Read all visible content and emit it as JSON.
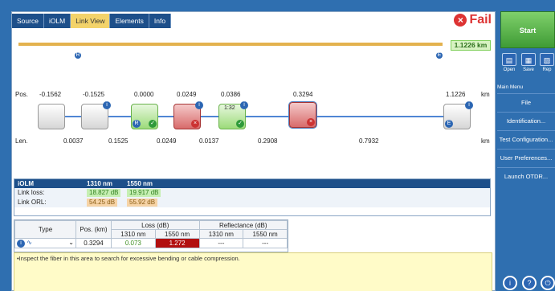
{
  "tabs": [
    "Source",
    "iOLM",
    "Link View",
    "Elements",
    "Info"
  ],
  "status": {
    "icon": "fail-icon",
    "text": "Fail"
  },
  "distance_label": "1.1226 km",
  "position_label": "Pos.",
  "length_label": "Len.",
  "unit_km": "km",
  "positions": [
    "-0.1562",
    "-0.1525",
    "0.0000",
    "0.0249",
    "0.0386",
    "0.3294",
    "1.1226"
  ],
  "lengths": [
    "0.0037",
    "0.1525",
    "0.0249",
    "0.0137",
    "0.2908",
    "0.7932"
  ],
  "element_text": {
    "splitter_ratio": "1:32"
  },
  "summary": {
    "headers": [
      "iOLM",
      "1310 nm",
      "1550 nm"
    ],
    "rows": [
      {
        "label": "Link loss:",
        "v1310": "18.827 dB",
        "v1550": "19.917 dB"
      },
      {
        "label": "Link ORL:",
        "v1310": "54.25 dB",
        "v1550": "55.92 dB"
      }
    ]
  },
  "grid": {
    "headers": {
      "type": "Type",
      "pos": "Pos. (km)",
      "loss": "Loss (dB)",
      "reflectance": "Reflectance (dB)"
    },
    "subheaders": {
      "l1310": "1310 nm",
      "l1550": "1550 nm",
      "r1310": "1310 nm",
      "r1550": "1550 nm"
    },
    "row": {
      "pos": "0.3294",
      "l1310": "0.073",
      "l1550": "1.272",
      "r1310": "---",
      "r1550": "---"
    }
  },
  "note": "•Inspect the fiber in this area to search for excessive bending or cable compression.",
  "sidebar": {
    "start_label": "Start",
    "tools": [
      {
        "label": "Open",
        "icon": "folder-icon"
      },
      {
        "label": "Save",
        "icon": "save-icon"
      },
      {
        "label": "Rep",
        "icon": "report-icon"
      }
    ],
    "menu_title": "Main Menu",
    "menu_items": [
      "File",
      "Identification...",
      "Test Configuration...",
      "User Preferences...",
      "Launch OTDR..."
    ]
  }
}
